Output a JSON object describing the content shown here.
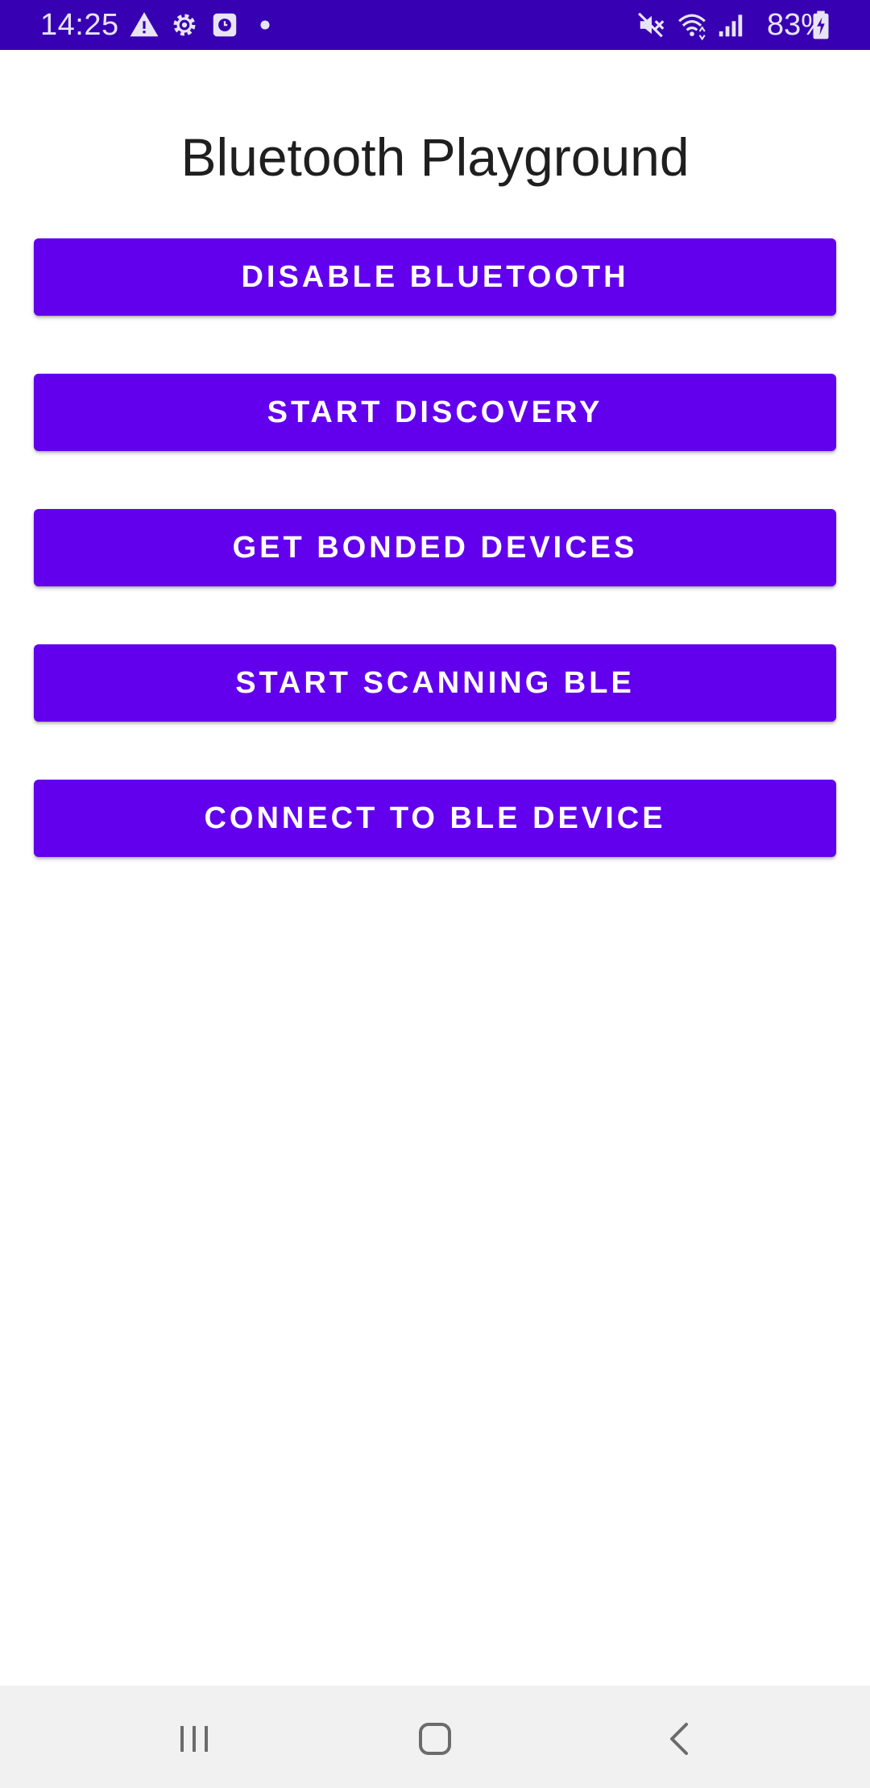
{
  "status_bar": {
    "time": "14:25",
    "battery": "83%",
    "icons": [
      "warning-icon",
      "gear-icon",
      "clock-app-icon",
      "dot-icon",
      "mute-icon",
      "wifi-icon",
      "signal-icon",
      "battery-charging-icon"
    ]
  },
  "title": "Bluetooth Playground",
  "buttons": [
    {
      "label": "DISABLE BLUETOOTH"
    },
    {
      "label": "START DISCOVERY"
    },
    {
      "label": "GET BONDED DEVICES"
    },
    {
      "label": "START SCANNING BLE"
    },
    {
      "label": "CONNECT TO BLE DEVICE"
    }
  ],
  "nav_bar": {
    "icons": [
      "recents-icon",
      "home-icon",
      "back-icon"
    ]
  },
  "colors": {
    "status_bar": "#3700b3",
    "accent": "#6200ee",
    "button_text": "#ffffff",
    "nav_bar": "#f1f1f1"
  }
}
